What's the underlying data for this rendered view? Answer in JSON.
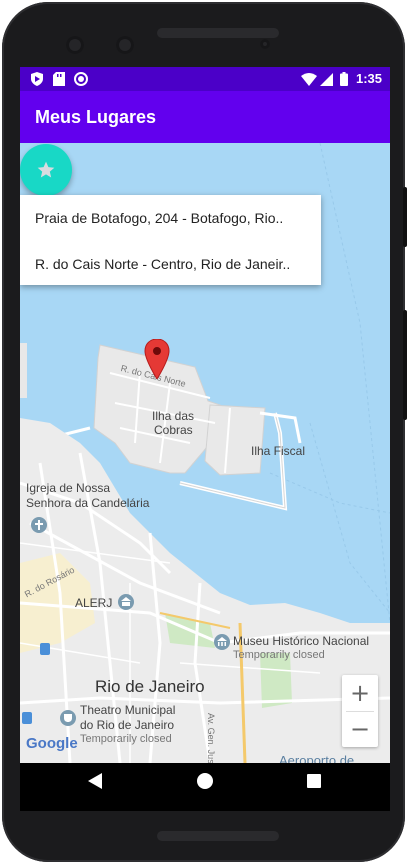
{
  "status_bar": {
    "time": "1:35"
  },
  "app_bar": {
    "title": "Meus Lugares"
  },
  "suggestions": [
    "Praia de Botafogo, 204 - Botafogo, Rio..",
    "R. do Cais Norte - Centro, Rio de Janeir.."
  ],
  "map": {
    "labels": {
      "cais_norte": "R. do Cais Norte",
      "ilha_das_cobras_1": "Ilha das",
      "ilha_das_cobras_2": "Cobras",
      "ilha_fiscal": "Ilha Fiscal",
      "igreja_1": "Igreja de Nossa",
      "igreja_2": "Senhora da Candelária",
      "rosario": "R. do Rosário",
      "alerj": "ALERJ",
      "museu": "Museu Histórico Nacional",
      "museu_status": "Temporarily closed",
      "rio": "Rio de Janeiro",
      "av_gen": "Av. Gen. Justo",
      "teatro_1": "Theatro Municipal",
      "teatro_2": "do Rio de Janeiro",
      "teatro_status": "Temporarily closed",
      "aeroporto": "Aeroporto de",
      "google": "Google"
    },
    "zoom_in": "+",
    "zoom_out": "−"
  },
  "colors": {
    "status_bar": "#4b00c8",
    "app_bar": "#6200ee",
    "fab": "#18d8c6",
    "water": "#a8d7f5"
  }
}
